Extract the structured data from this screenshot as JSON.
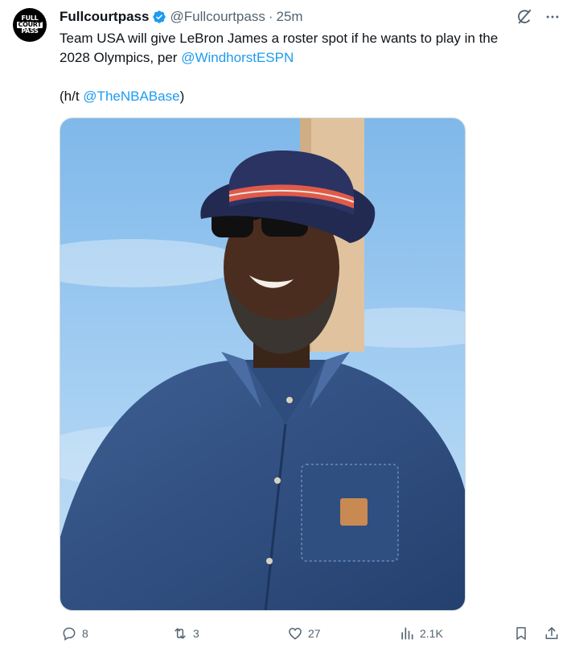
{
  "author": {
    "display_name": "Fullcourtpass",
    "handle": "@Fullcourtpass",
    "separator": "·",
    "time": "25m",
    "avatar_lines": [
      "FULL",
      "COURT",
      "PASS"
    ]
  },
  "tweet": {
    "line1": "Team USA will give LeBron James a roster spot if he wants to play in the",
    "line2_prefix": "2028 Olympics, per ",
    "mention1": "@WindhorstESPN",
    "hat_tip_prefix": "(h/t ",
    "mention2": "@TheNBABase",
    "hat_tip_suffix": ")"
  },
  "media": {
    "description_icon": "photo"
  },
  "actions": {
    "replies": "8",
    "reposts": "3",
    "likes": "27",
    "views": "2.1K"
  },
  "colors": {
    "accent": "#1d9bf0",
    "muted": "#536471",
    "text": "#0f1419"
  },
  "icons": [
    "verified-badge-icon",
    "grok-icon",
    "more-icon",
    "reply-icon",
    "retweet-icon",
    "like-icon",
    "views-icon",
    "bookmark-icon",
    "share-icon"
  ]
}
